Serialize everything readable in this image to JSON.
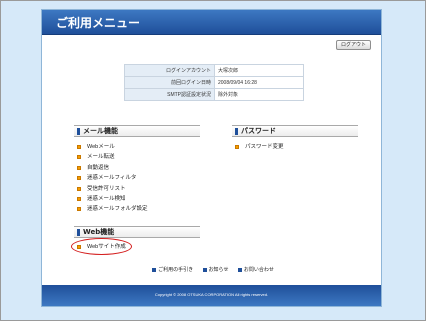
{
  "header": {
    "title": "ご利用メニュー"
  },
  "logout_label": "ログアウト",
  "info_rows": [
    {
      "label": "ログインアカウント",
      "value": "大塚次郎"
    },
    {
      "label": "前回ログイン日時",
      "value": "2008/09/04 16:28"
    },
    {
      "label": "SMTP認証設定状況",
      "value": "除外対象"
    }
  ],
  "mail_section": {
    "title": "メール機能",
    "items": [
      "Webメール",
      "メール転送",
      "自動返信",
      "迷惑メールフィルタ",
      "受信許可リスト",
      "迷惑メール検知",
      "迷惑メールフォルダ設定"
    ]
  },
  "password_section": {
    "title": "パスワード",
    "items": [
      "パスワード変更"
    ]
  },
  "web_section": {
    "title": "Web機能",
    "items": [
      "Webサイト作成"
    ]
  },
  "footer_links": [
    "ご利用の手引き",
    "お知らせ",
    "お問い合わせ"
  ],
  "copyright": "Copyright © 2008 OTSUKA CORPORATION All rights reserved.",
  "colors": {
    "brand": "#1f4f9a",
    "bullet": "#f59e00",
    "highlight_ring": "#d41e1e",
    "background": "#d6e9f9"
  }
}
